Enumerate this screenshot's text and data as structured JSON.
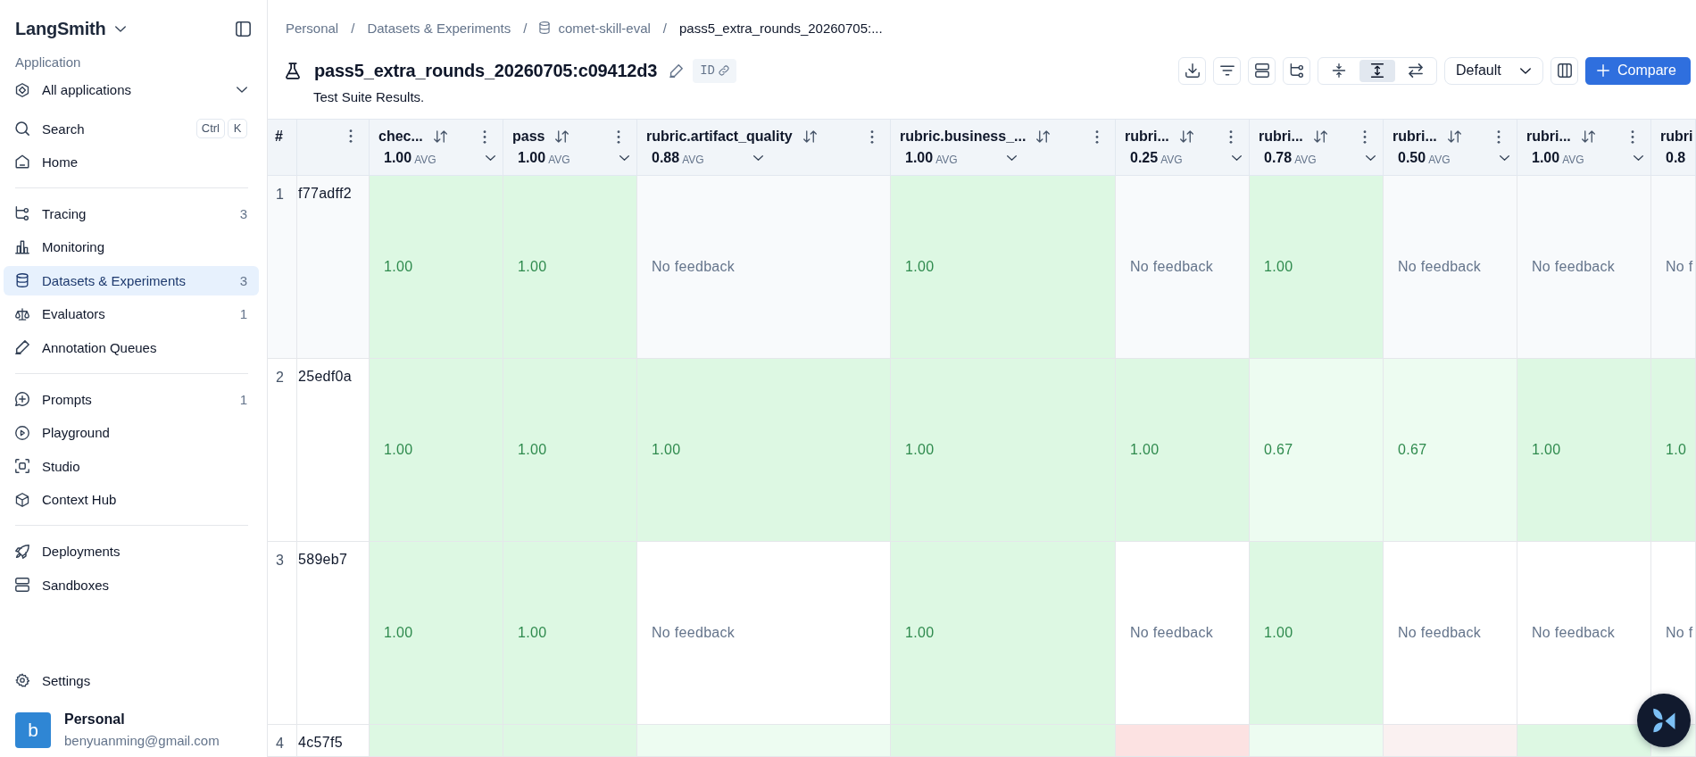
{
  "sidebar": {
    "brand": "LangSmith",
    "section_label": "Application",
    "app_selector": "All applications",
    "search": {
      "label": "Search",
      "keys": [
        "Ctrl",
        "K"
      ]
    },
    "groups": [
      [
        {
          "label": "Home",
          "selected": false
        }
      ],
      [
        {
          "label": "Tracing",
          "count": "3",
          "selected": false
        },
        {
          "label": "Monitoring",
          "selected": false
        },
        {
          "label": "Datasets & Experiments",
          "count": "3",
          "selected": true
        },
        {
          "label": "Evaluators",
          "count": "1",
          "selected": false
        },
        {
          "label": "Annotation Queues",
          "selected": false
        }
      ],
      [
        {
          "label": "Prompts",
          "count": "1",
          "selected": false
        },
        {
          "label": "Playground",
          "selected": false
        },
        {
          "label": "Studio",
          "selected": false
        },
        {
          "label": "Context Hub",
          "selected": false
        }
      ],
      [
        {
          "label": "Deployments",
          "selected": false
        },
        {
          "label": "Sandboxes",
          "selected": false
        }
      ]
    ],
    "settings": "Settings",
    "user": {
      "initial": "b",
      "name": "Personal",
      "email": "benyuanming@gmail.com"
    }
  },
  "breadcrumb": {
    "items": [
      {
        "kind": "link",
        "label": "Personal"
      },
      {
        "kind": "link",
        "separator": "/",
        "label": "Datasets & Experiments"
      },
      {
        "kind": "dataset",
        "separator": "/",
        "label": "comet-skill-eval"
      },
      {
        "kind": "current",
        "separator": "/",
        "label": "pass5_extra_rounds_20260705:..."
      }
    ]
  },
  "experiment": {
    "title": "pass5_extra_rounds_20260705:c09412d3",
    "id_button": "ID",
    "description": "Test Suite Results."
  },
  "toolbar": {
    "view_modes": [
      {
        "selected": false
      },
      {
        "selected": true
      },
      {
        "selected": false
      }
    ],
    "preset": "Default",
    "compare": "Compare"
  },
  "table": {
    "number_heading": "#",
    "columns": [
      {
        "kind": "feedback",
        "name": "chec...",
        "average": "1.00",
        "average_label": "AVG"
      },
      {
        "kind": "feedback",
        "name": "pass",
        "average": "1.00",
        "average_label": "AVG"
      },
      {
        "kind": "feedback",
        "name": "rubric.artifact_quality",
        "average": "0.88",
        "average_label": "AVG"
      },
      {
        "kind": "feedback",
        "name": "rubric.business_...",
        "average": "1.00",
        "average_label": "AVG"
      },
      {
        "kind": "feedback",
        "name": "rubri...",
        "average": "0.25",
        "average_label": "AVG"
      },
      {
        "kind": "feedback",
        "name": "rubri...",
        "average": "0.78",
        "average_label": "AVG"
      },
      {
        "kind": "feedback",
        "name": "rubri...",
        "average": "0.50",
        "average_label": "AVG"
      },
      {
        "kind": "feedback",
        "name": "rubri...",
        "average": "1.00",
        "average_label": "AVG"
      },
      {
        "kind": "clipped",
        "name": "rubri",
        "average": "0.8"
      }
    ],
    "rows": [
      {
        "number": "1",
        "id": "f77adff2",
        "color": "#f8fafc",
        "cells": [
          {
            "kind": "score",
            "text": "1.00",
            "color": "#ddf8e3"
          },
          {
            "kind": "score",
            "text": "1.00",
            "color": "#ddf8e3"
          },
          {
            "kind": "empty",
            "text": "No feedback"
          },
          {
            "kind": "score",
            "text": "1.00",
            "color": "#ddf8e3"
          },
          {
            "kind": "empty",
            "text": "No feedback"
          },
          {
            "kind": "score",
            "text": "1.00",
            "color": "#ddf8e3"
          },
          {
            "kind": "empty",
            "text": "No feedback"
          },
          {
            "kind": "empty",
            "text": "No feedback"
          },
          {
            "kind": "empty",
            "text": "No f"
          }
        ]
      },
      {
        "number": "2",
        "id": "25edf0a",
        "cells": [
          {
            "kind": "score",
            "text": "1.00",
            "color": "#ddf8e3"
          },
          {
            "kind": "score",
            "text": "1.00",
            "color": "#ddf8e3"
          },
          {
            "kind": "score",
            "text": "1.00",
            "color": "#ddf8e3"
          },
          {
            "kind": "score",
            "text": "1.00",
            "color": "#ddf8e3"
          },
          {
            "kind": "score",
            "text": "1.00",
            "color": "#ddf8e3"
          },
          {
            "kind": "score",
            "text": "0.67",
            "color": "#edfcf1"
          },
          {
            "kind": "score",
            "text": "0.67",
            "color": "#edfcf1"
          },
          {
            "kind": "score",
            "text": "1.00",
            "color": "#ddf8e3"
          },
          {
            "kind": "score",
            "text": "1.0",
            "color": "#ddf8e3"
          }
        ]
      },
      {
        "number": "3",
        "id": "589eb7",
        "cells": [
          {
            "kind": "score",
            "text": "1.00",
            "color": "#ddf8e3"
          },
          {
            "kind": "score",
            "text": "1.00",
            "color": "#ddf8e3"
          },
          {
            "kind": "empty",
            "text": "No feedback"
          },
          {
            "kind": "score",
            "text": "1.00",
            "color": "#ddf8e3"
          },
          {
            "kind": "empty",
            "text": "No feedback"
          },
          {
            "kind": "score",
            "text": "1.00",
            "color": "#ddf8e3"
          },
          {
            "kind": "empty",
            "text": "No feedback"
          },
          {
            "kind": "empty",
            "text": "No feedback"
          },
          {
            "kind": "empty",
            "text": "No f"
          }
        ]
      },
      {
        "number": "4",
        "id": "4c57f5",
        "cells": [
          {
            "color": "#ddf8e3"
          },
          {
            "color": "#ddf8e3"
          },
          {
            "color": "#edfcf1"
          },
          {
            "color": "#ddf8e3"
          },
          {
            "color": "#fce2e2"
          },
          {
            "color": "#edfcf1"
          },
          {
            "color": "#faf1f1"
          },
          {
            "color": "#ddf8e3"
          },
          {
            "color": "#edfcf1"
          }
        ]
      }
    ]
  }
}
